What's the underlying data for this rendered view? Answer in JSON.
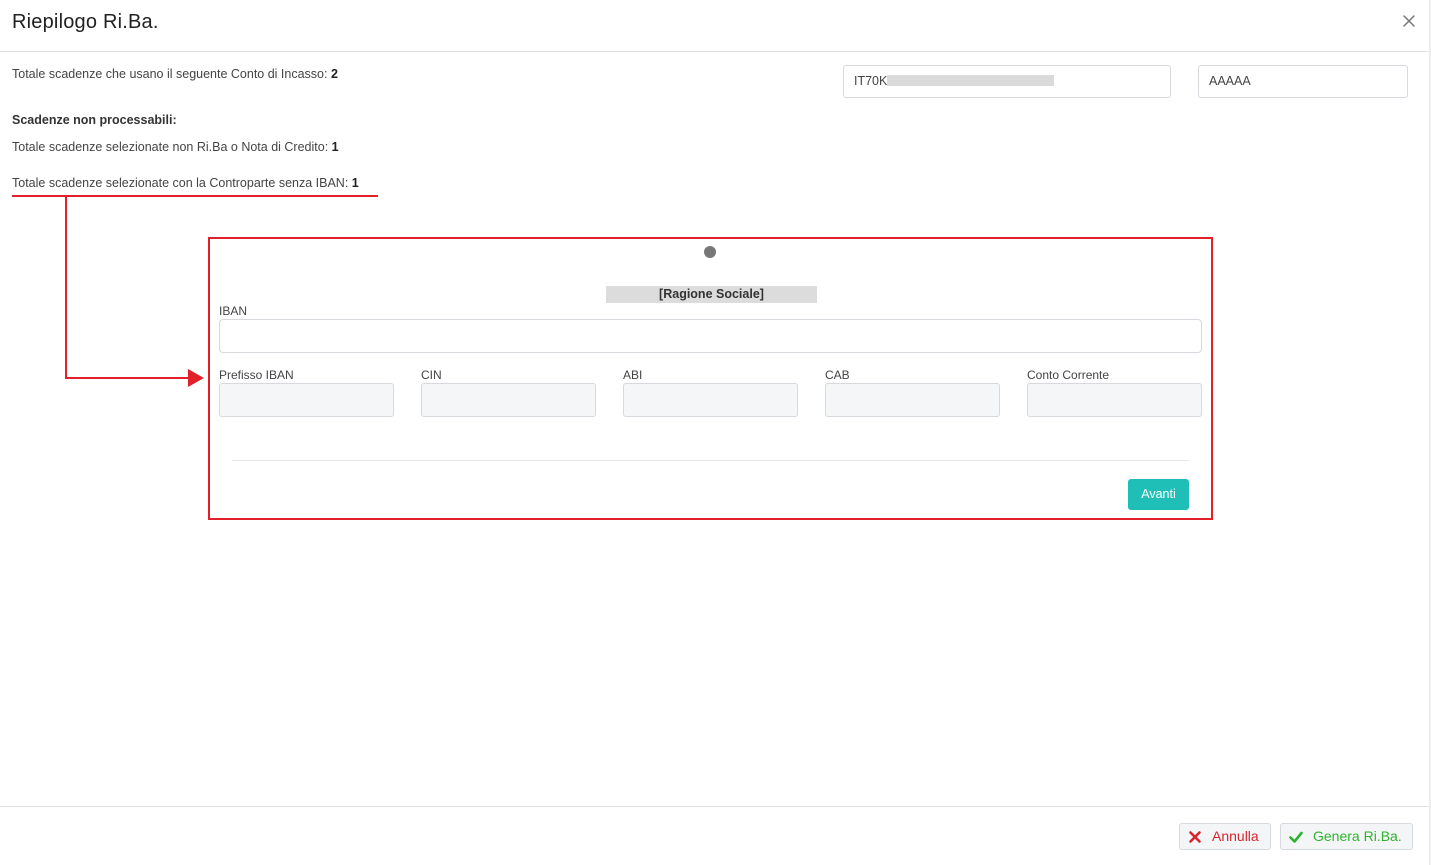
{
  "modal": {
    "title": "Riepilogo Ri.Ba."
  },
  "summary": {
    "totale_incasso_label": "Totale scadenze che usano il seguente Conto di Incasso:",
    "totale_incasso_value": "2",
    "iban_prefix": "IT70K",
    "account_code": "AAAAA",
    "non_processabili_title": "Scadenze non processabili:",
    "non_riba_label": "Totale scadenze selezionate non Ri.Ba o Nota di Credito:",
    "non_riba_value": "1",
    "senza_iban_label": "Totale scadenze selezionate con la Controparte senza IBAN:",
    "senza_iban_value": "1"
  },
  "wizard": {
    "ragione_sociale": "[Ragione Sociale]",
    "iban_label": "IBAN",
    "prefisso_label": "Prefisso IBAN",
    "cin_label": "CIN",
    "abi_label": "ABI",
    "cab_label": "CAB",
    "conto_label": "Conto Corrente",
    "next_button": "Avanti"
  },
  "footer": {
    "cancel_label": "Annulla",
    "generate_label": "Genera Ri.Ba."
  },
  "colors": {
    "accent_teal": "#1fbfb8",
    "annotation_red": "#e2202a",
    "cancel_red": "#d7262f",
    "confirm_green": "#2eb32e"
  },
  "icons": {
    "close": "close-icon",
    "cancel": "x-icon",
    "confirm": "check-icon",
    "annotation": "arrow-right-icon"
  }
}
